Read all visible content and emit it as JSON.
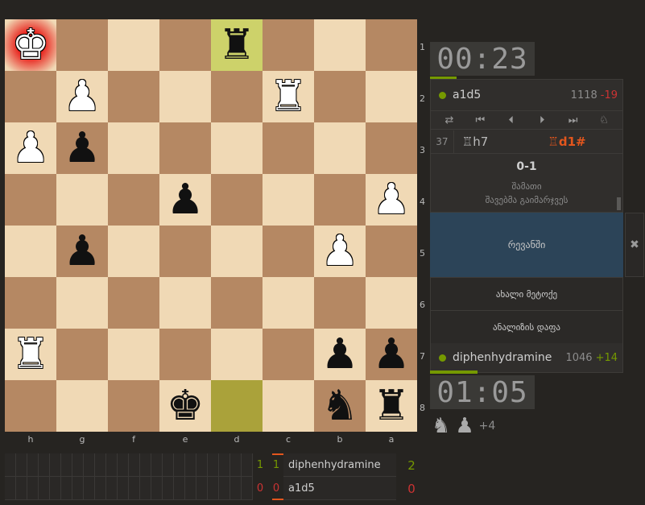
{
  "board": {
    "orientation": "black",
    "files_display": [
      "h",
      "g",
      "f",
      "e",
      "d",
      "c",
      "b",
      "a"
    ],
    "ranks_display": [
      "1",
      "2",
      "3",
      "4",
      "5",
      "6",
      "7",
      "8"
    ],
    "rows": [
      [
        "wk",
        "",
        "",
        "",
        "br",
        "",
        "",
        ""
      ],
      [
        "",
        "wp",
        "",
        "",
        "",
        "wr",
        "",
        ""
      ],
      [
        "wp",
        "bp",
        "",
        "",
        "",
        "",
        "",
        ""
      ],
      [
        "",
        "",
        "",
        "bp",
        "",
        "",
        "",
        "wp"
      ],
      [
        "",
        "bp",
        "",
        "",
        "",
        "",
        "wp",
        ""
      ],
      [
        "",
        "",
        "",
        "",
        "",
        "",
        "",
        ""
      ],
      [
        "wr",
        "",
        "",
        "",
        "",
        "",
        "bp",
        "bp"
      ],
      [
        "",
        "",
        "",
        "bk",
        "",
        "",
        "bn",
        "br"
      ]
    ],
    "highlights": [
      [
        0,
        4
      ],
      [
        7,
        4
      ]
    ],
    "check": [
      0,
      0
    ]
  },
  "opponent": {
    "clock": "00:23",
    "name": "a1d5",
    "rating": "1118",
    "diff": "-19",
    "clock_progress": 0.25
  },
  "player": {
    "clock": "01:05",
    "name": "diphenhydramine",
    "rating": "1046",
    "diff": "+14",
    "clock_progress": 0.45
  },
  "controls": {
    "flip": "⇄",
    "first": "⏮",
    "prev": "⏴",
    "next": "⏵",
    "last": "⏭",
    "analysis": "♘"
  },
  "moves": {
    "number": "37",
    "white": "♖h7",
    "black": "♖d1#"
  },
  "result": {
    "score": "0-1",
    "status": "შამათი",
    "winner": "შავებმა გაიმარჯვეს"
  },
  "actions": {
    "rematch": "რევანში",
    "close": "✖",
    "new_opponent": "ახალი მეტოქე",
    "analysis_board": "ანალიზის დაფა"
  },
  "material": {
    "pieces": [
      "♞",
      "♟"
    ],
    "score": "+4"
  },
  "crosstable": {
    "players": [
      {
        "name": "diphenhydramine",
        "games": [
          "1",
          "1"
        ],
        "total": "2",
        "result": "win"
      },
      {
        "name": "a1d5",
        "games": [
          "0",
          "0"
        ],
        "total": "0",
        "result": "loss"
      }
    ]
  },
  "colors": {
    "light": "#f0d9b5",
    "dark": "#b58863",
    "last_move": "#cdd26a",
    "accent_green": "#759900",
    "accent_red": "#cc3333",
    "rematch_bg": "#2c4458"
  }
}
